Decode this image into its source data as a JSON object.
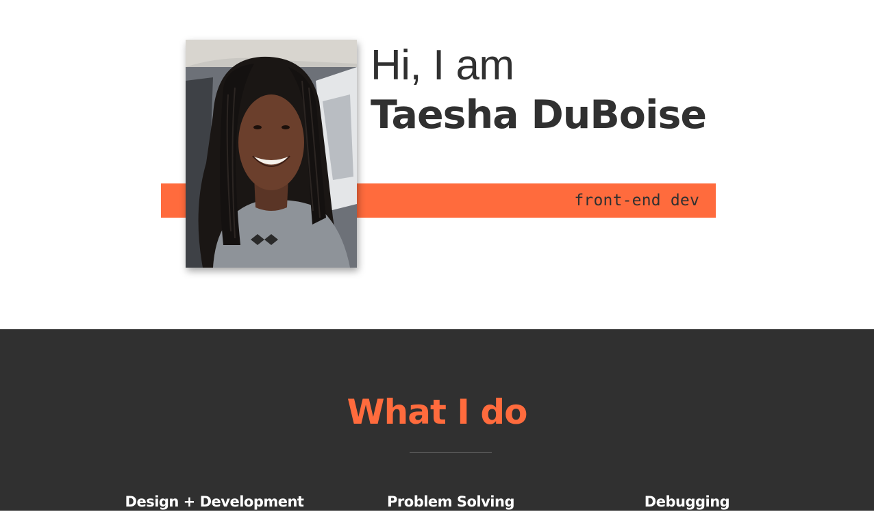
{
  "intro": {
    "greeting": "Hi, I am",
    "name": "Taesha DuBoise",
    "subtitle": "front-end dev",
    "accent_color": "#ff6b3d",
    "photo_alt": "Taesha DuBoise"
  },
  "what_i_do": {
    "title": "What I do",
    "background_color": "#303030",
    "skills": [
      {
        "title": "Design + Development"
      },
      {
        "title": "Problem Solving"
      },
      {
        "title": "Debugging"
      }
    ]
  }
}
